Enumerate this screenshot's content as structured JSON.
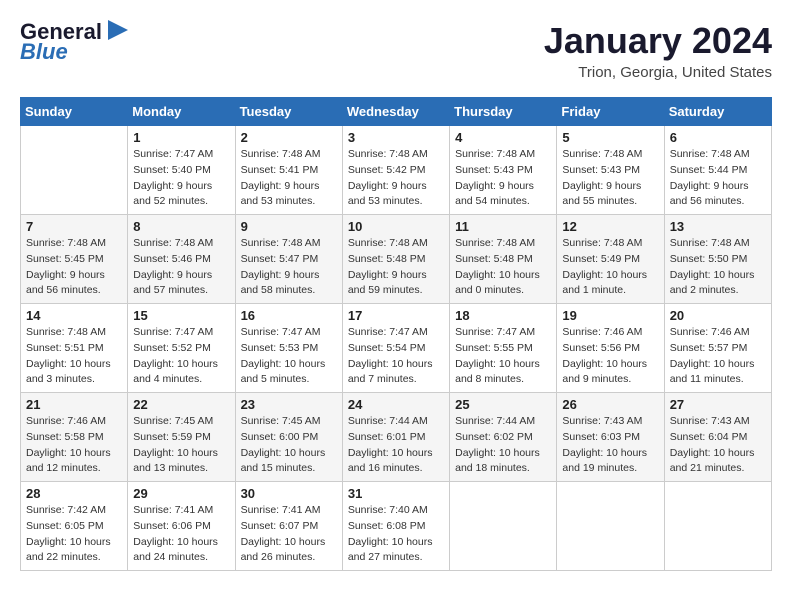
{
  "header": {
    "logo_line1": "General",
    "logo_line2": "Blue",
    "month": "January 2024",
    "location": "Trion, Georgia, United States"
  },
  "weekdays": [
    "Sunday",
    "Monday",
    "Tuesday",
    "Wednesday",
    "Thursday",
    "Friday",
    "Saturday"
  ],
  "weeks": [
    [
      {
        "day": "",
        "info": ""
      },
      {
        "day": "1",
        "info": "Sunrise: 7:47 AM\nSunset: 5:40 PM\nDaylight: 9 hours\nand 52 minutes."
      },
      {
        "day": "2",
        "info": "Sunrise: 7:48 AM\nSunset: 5:41 PM\nDaylight: 9 hours\nand 53 minutes."
      },
      {
        "day": "3",
        "info": "Sunrise: 7:48 AM\nSunset: 5:42 PM\nDaylight: 9 hours\nand 53 minutes."
      },
      {
        "day": "4",
        "info": "Sunrise: 7:48 AM\nSunset: 5:43 PM\nDaylight: 9 hours\nand 54 minutes."
      },
      {
        "day": "5",
        "info": "Sunrise: 7:48 AM\nSunset: 5:43 PM\nDaylight: 9 hours\nand 55 minutes."
      },
      {
        "day": "6",
        "info": "Sunrise: 7:48 AM\nSunset: 5:44 PM\nDaylight: 9 hours\nand 56 minutes."
      }
    ],
    [
      {
        "day": "7",
        "info": "Sunrise: 7:48 AM\nSunset: 5:45 PM\nDaylight: 9 hours\nand 56 minutes."
      },
      {
        "day": "8",
        "info": "Sunrise: 7:48 AM\nSunset: 5:46 PM\nDaylight: 9 hours\nand 57 minutes."
      },
      {
        "day": "9",
        "info": "Sunrise: 7:48 AM\nSunset: 5:47 PM\nDaylight: 9 hours\nand 58 minutes."
      },
      {
        "day": "10",
        "info": "Sunrise: 7:48 AM\nSunset: 5:48 PM\nDaylight: 9 hours\nand 59 minutes."
      },
      {
        "day": "11",
        "info": "Sunrise: 7:48 AM\nSunset: 5:48 PM\nDaylight: 10 hours\nand 0 minutes."
      },
      {
        "day": "12",
        "info": "Sunrise: 7:48 AM\nSunset: 5:49 PM\nDaylight: 10 hours\nand 1 minute."
      },
      {
        "day": "13",
        "info": "Sunrise: 7:48 AM\nSunset: 5:50 PM\nDaylight: 10 hours\nand 2 minutes."
      }
    ],
    [
      {
        "day": "14",
        "info": "Sunrise: 7:48 AM\nSunset: 5:51 PM\nDaylight: 10 hours\nand 3 minutes."
      },
      {
        "day": "15",
        "info": "Sunrise: 7:47 AM\nSunset: 5:52 PM\nDaylight: 10 hours\nand 4 minutes."
      },
      {
        "day": "16",
        "info": "Sunrise: 7:47 AM\nSunset: 5:53 PM\nDaylight: 10 hours\nand 5 minutes."
      },
      {
        "day": "17",
        "info": "Sunrise: 7:47 AM\nSunset: 5:54 PM\nDaylight: 10 hours\nand 7 minutes."
      },
      {
        "day": "18",
        "info": "Sunrise: 7:47 AM\nSunset: 5:55 PM\nDaylight: 10 hours\nand 8 minutes."
      },
      {
        "day": "19",
        "info": "Sunrise: 7:46 AM\nSunset: 5:56 PM\nDaylight: 10 hours\nand 9 minutes."
      },
      {
        "day": "20",
        "info": "Sunrise: 7:46 AM\nSunset: 5:57 PM\nDaylight: 10 hours\nand 11 minutes."
      }
    ],
    [
      {
        "day": "21",
        "info": "Sunrise: 7:46 AM\nSunset: 5:58 PM\nDaylight: 10 hours\nand 12 minutes."
      },
      {
        "day": "22",
        "info": "Sunrise: 7:45 AM\nSunset: 5:59 PM\nDaylight: 10 hours\nand 13 minutes."
      },
      {
        "day": "23",
        "info": "Sunrise: 7:45 AM\nSunset: 6:00 PM\nDaylight: 10 hours\nand 15 minutes."
      },
      {
        "day": "24",
        "info": "Sunrise: 7:44 AM\nSunset: 6:01 PM\nDaylight: 10 hours\nand 16 minutes."
      },
      {
        "day": "25",
        "info": "Sunrise: 7:44 AM\nSunset: 6:02 PM\nDaylight: 10 hours\nand 18 minutes."
      },
      {
        "day": "26",
        "info": "Sunrise: 7:43 AM\nSunset: 6:03 PM\nDaylight: 10 hours\nand 19 minutes."
      },
      {
        "day": "27",
        "info": "Sunrise: 7:43 AM\nSunset: 6:04 PM\nDaylight: 10 hours\nand 21 minutes."
      }
    ],
    [
      {
        "day": "28",
        "info": "Sunrise: 7:42 AM\nSunset: 6:05 PM\nDaylight: 10 hours\nand 22 minutes."
      },
      {
        "day": "29",
        "info": "Sunrise: 7:41 AM\nSunset: 6:06 PM\nDaylight: 10 hours\nand 24 minutes."
      },
      {
        "day": "30",
        "info": "Sunrise: 7:41 AM\nSunset: 6:07 PM\nDaylight: 10 hours\nand 26 minutes."
      },
      {
        "day": "31",
        "info": "Sunrise: 7:40 AM\nSunset: 6:08 PM\nDaylight: 10 hours\nand 27 minutes."
      },
      {
        "day": "",
        "info": ""
      },
      {
        "day": "",
        "info": ""
      },
      {
        "day": "",
        "info": ""
      }
    ]
  ]
}
